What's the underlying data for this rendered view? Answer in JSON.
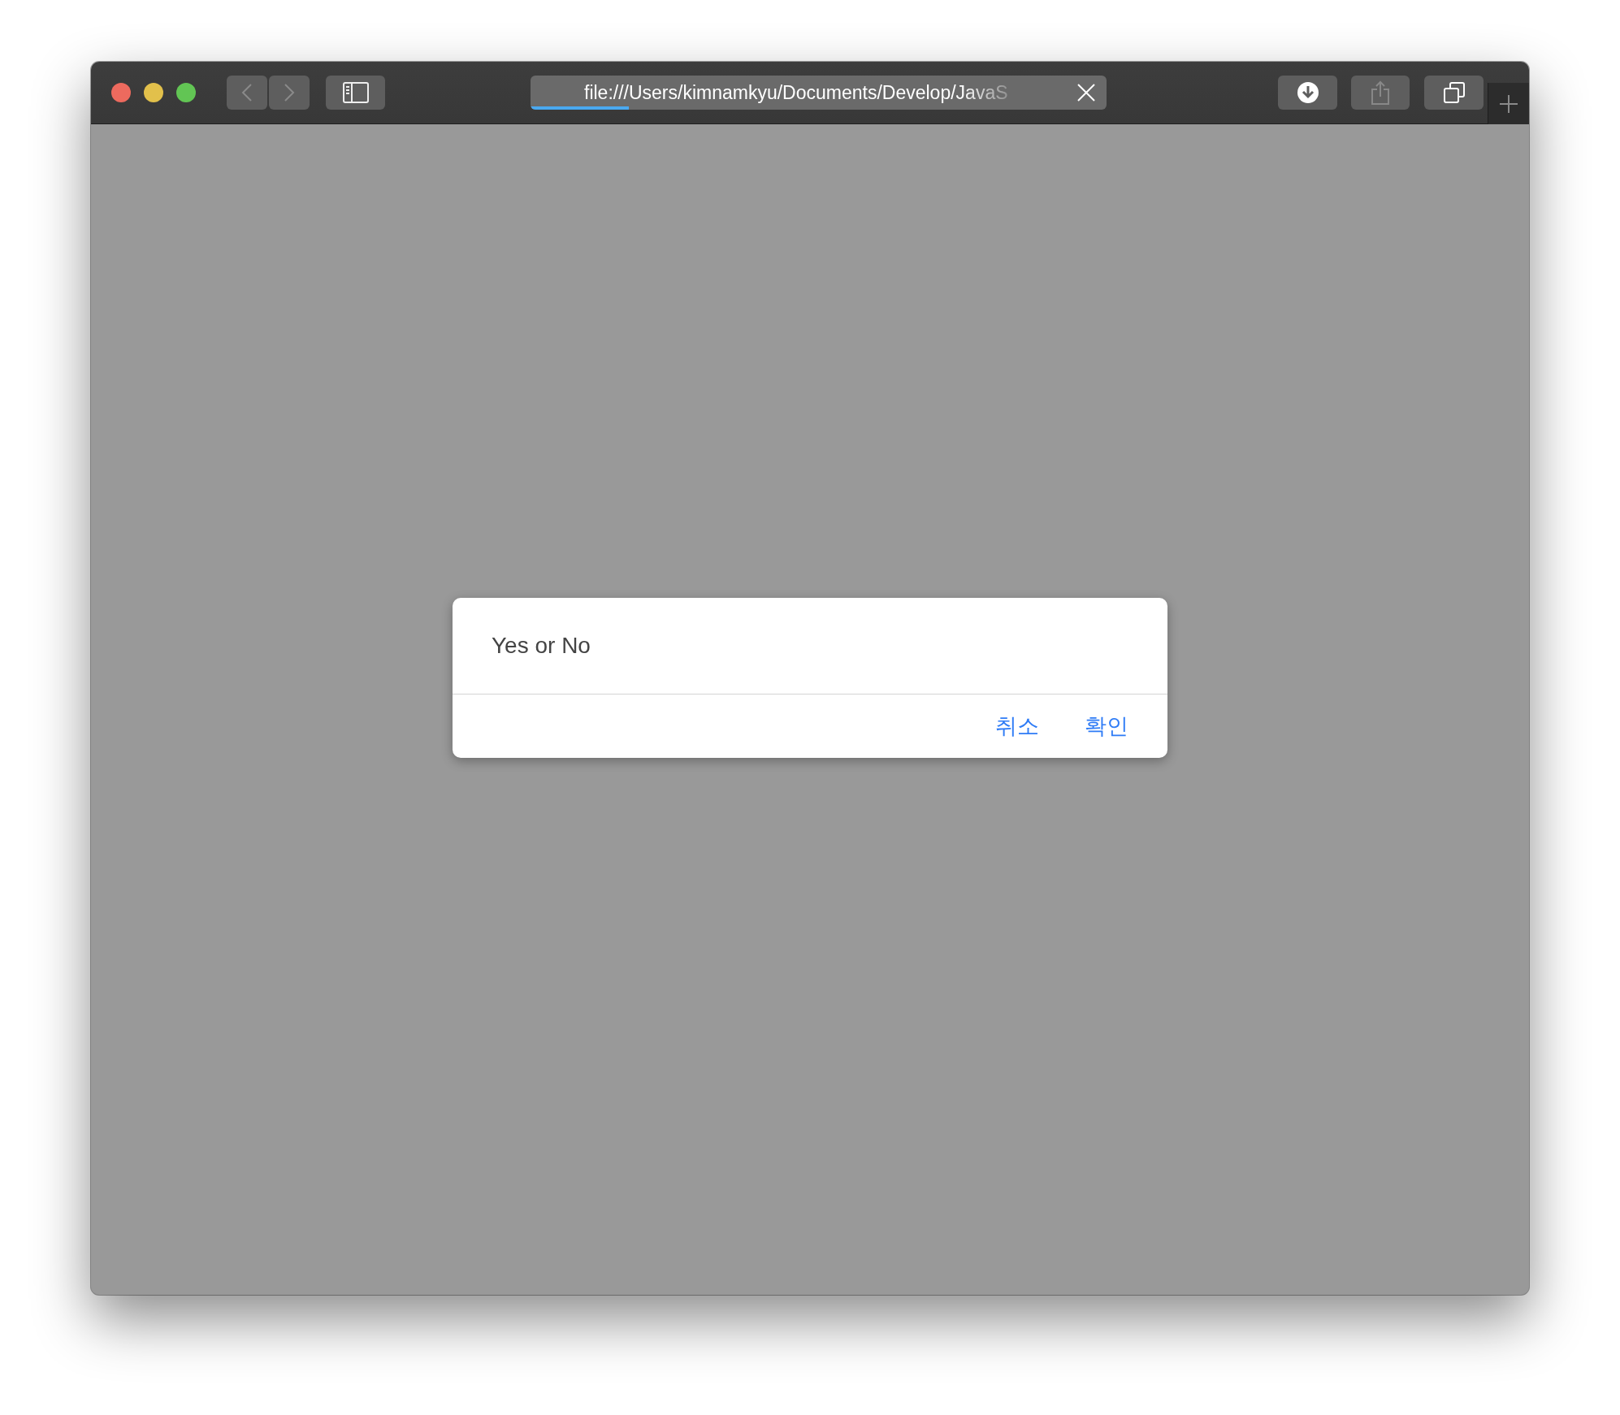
{
  "window": {
    "traffic_lights": [
      {
        "color": "#ed6a5e"
      },
      {
        "color": "#e2c04b"
      },
      {
        "color": "#62c554"
      }
    ]
  },
  "address_bar": {
    "url": "file:///Users/kimnamkyu/Documents/Develop/JavaS",
    "level": 0.17
  },
  "dialog": {
    "message": "Yes or No",
    "buttons": [
      {
        "label": "취소"
      },
      {
        "label": "확인"
      }
    ]
  }
}
